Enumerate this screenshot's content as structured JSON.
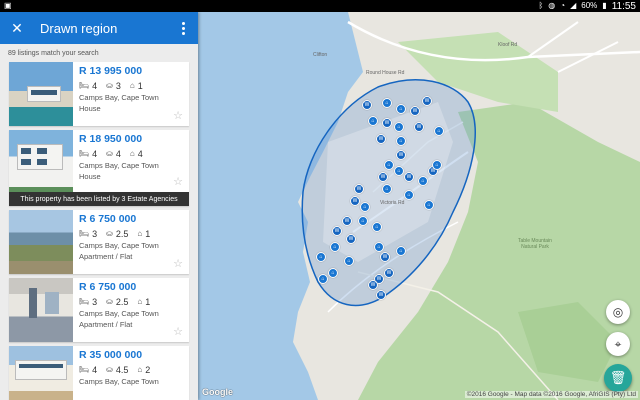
{
  "statusbar": {
    "battery": "60%",
    "time": "11:55"
  },
  "panel": {
    "title": "Drawn region",
    "match_count": "89 listings match your search",
    "listings": [
      {
        "price": "R 13 995 000",
        "beds": "4",
        "baths": "3",
        "garages": "1",
        "location": "Camps Bay, Cape Town",
        "type": "House"
      },
      {
        "price": "R 18 950 000",
        "beds": "4",
        "baths": "4",
        "garages": "4",
        "location": "Camps Bay, Cape Town",
        "type": "House",
        "agency_note": "This property has been listed by 3 Estate Agencies"
      },
      {
        "price": "R 6 750 000",
        "beds": "3",
        "baths": "2.5",
        "garages": "1",
        "location": "Camps Bay, Cape Town",
        "type": "Apartment / Flat"
      },
      {
        "price": "R 6 750 000",
        "beds": "3",
        "baths": "2.5",
        "garages": "1",
        "location": "Camps Bay, Cape Town",
        "type": "Apartment / Flat"
      },
      {
        "price": "R 35 000 000",
        "beds": "4",
        "baths": "4.5",
        "garages": "2",
        "location": "Camps Bay, Cape Town",
        "type": ""
      }
    ]
  },
  "map": {
    "google": "Google",
    "attribution": "©2016 Google - Map data ©2016 Google, AfriGIS (Pty) Ltd",
    "park_label": "Table Mountain Natural Park",
    "labels": [
      "Clifton",
      "Round House Rd",
      "Kloof Rd",
      "Victoria Rd"
    ],
    "colors": {
      "water": "#a3c8e7",
      "land": "#e8e6e0",
      "park": "#b7d7a6",
      "region": "#1565c0",
      "accent": "#1976d2"
    }
  }
}
